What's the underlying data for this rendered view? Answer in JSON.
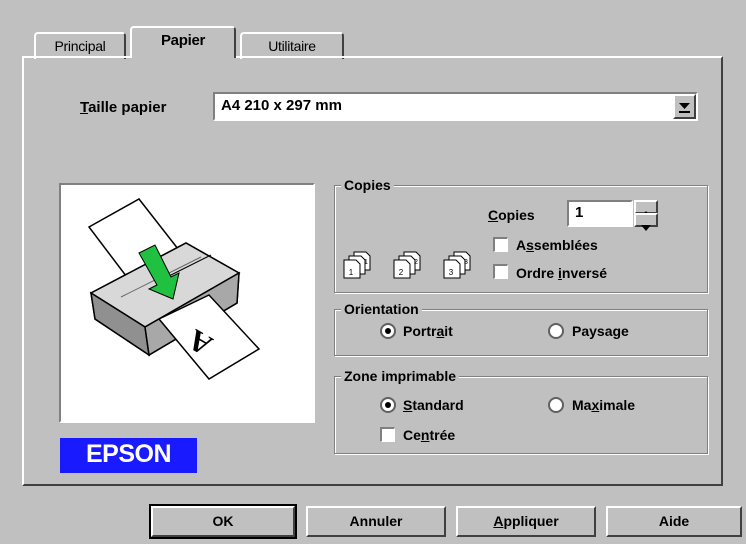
{
  "tabs": [
    {
      "label": "Principal"
    },
    {
      "label": "Papier"
    },
    {
      "label": "Utilitaire"
    }
  ],
  "paper_size": {
    "label": "Taille papier",
    "mnemonic": "T",
    "label_rest": "aille papier",
    "value": "A4 210 x 297 mm"
  },
  "copies_group": {
    "title": "Copies",
    "copies_label_m": "C",
    "copies_label_rest": "opies",
    "copies_value": "1",
    "collate_m_pre": "A",
    "collate_m": "s",
    "collate_rest": "semblées",
    "reverse_pre": "Ordre ",
    "reverse_m": "i",
    "reverse_rest": "nversé",
    "collate_checked": false,
    "reverse_checked": false,
    "icon_pages": [
      "1",
      "2",
      "3"
    ]
  },
  "orientation_group": {
    "title": "Orientation",
    "portrait_pre": "Portr",
    "portrait_m": "a",
    "portrait_rest": "it",
    "landscape_pre": "Paysa",
    "landscape_m": "g",
    "landscape_rest": "e",
    "selected": "Portrait"
  },
  "printable_group": {
    "title": "Zone imprimable",
    "standard_m": "S",
    "standard_rest": "tandard",
    "maximal_pre": "Ma",
    "maximal_m": "x",
    "maximal_rest": "imale",
    "centered_pre": "Ce",
    "centered_m": "n",
    "centered_rest": "trée",
    "selected": "Standard",
    "centered_checked": false
  },
  "preview": {
    "paper_letter": "A"
  },
  "brand": {
    "logo_text": "EPSON",
    "logo_color": "#1a1aff"
  },
  "buttons": {
    "ok": "OK",
    "cancel": "Annuler",
    "apply_m": "A",
    "apply_rest": "ppliquer",
    "help": "Aide"
  }
}
